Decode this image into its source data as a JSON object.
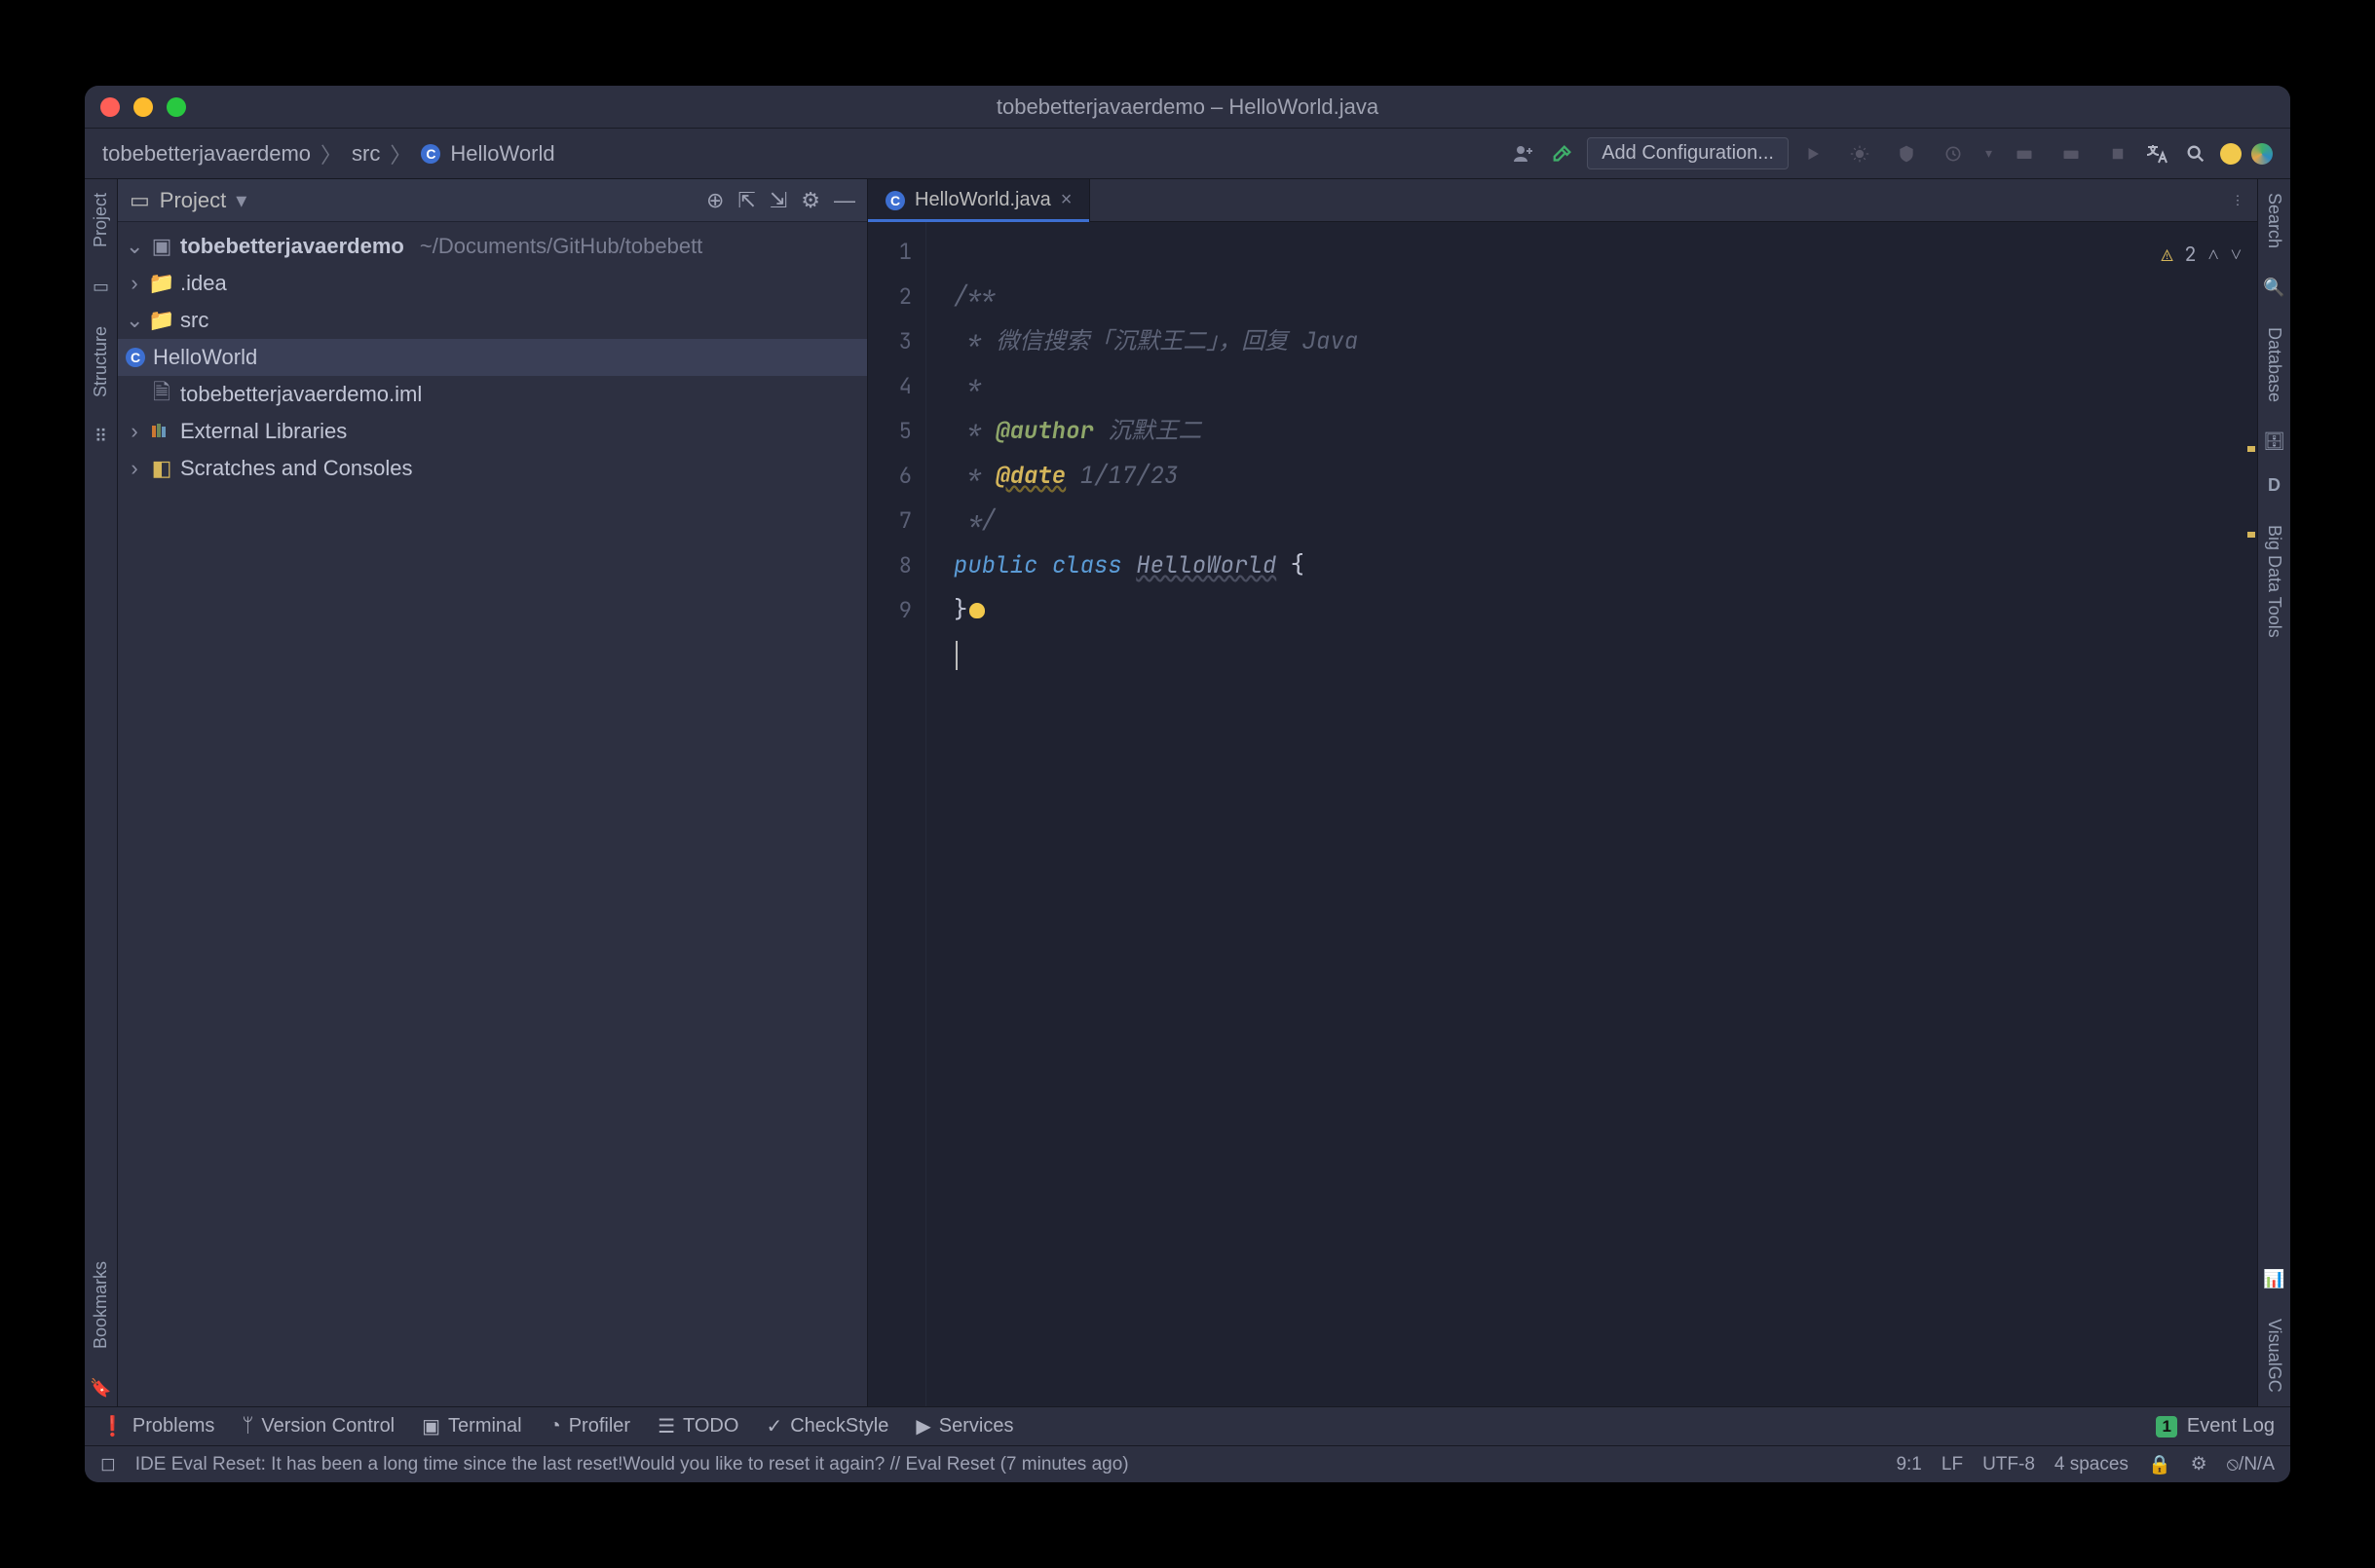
{
  "window_title": "tobebetterjavaerdemo – HelloWorld.java",
  "breadcrumb": {
    "project": "tobebetterjavaerdemo",
    "folder": "src",
    "file": "HelloWorld"
  },
  "toolbar": {
    "add_configuration": "Add Configuration..."
  },
  "left_rail": {
    "project": "Project",
    "structure": "Structure",
    "bookmarks": "Bookmarks"
  },
  "right_rail": {
    "search": "Search",
    "database": "Database",
    "big_data": "Big Data Tools",
    "visualgc": "VisualGC",
    "d_label": "D"
  },
  "project_panel": {
    "title": "Project",
    "root": "tobebetterjavaerdemo",
    "root_path": "~/Documents/GitHub/tobebett",
    "idea_dir": ".idea",
    "src_dir": "src",
    "selected_class": "HelloWorld",
    "iml": "tobebetterjavaerdemo.iml",
    "ext_libs": "External Libraries",
    "scratches": "Scratches and Consoles"
  },
  "editor": {
    "tab_label": "HelloWorld.java",
    "inspection_count": "2",
    "lines": {
      "l1": "/**",
      "l2_prefix": " * ",
      "l2_text": "微信搜索「沉默王二」，回复 Java",
      "l3": " *",
      "l4_prefix": " * ",
      "l4_tag": "@author",
      "l4_val": " 沉默王二",
      "l5_prefix": " * ",
      "l5_tag": "@date",
      "l5_val": " 1/17/23",
      "l6": " */",
      "l7_kw1": "public",
      "l7_kw2": "class",
      "l7_cls": "HelloWorld",
      "l7_brace": " {",
      "l8": "}",
      "l9": ""
    },
    "gutter": [
      "1",
      "2",
      "3",
      "4",
      "5",
      "6",
      "7",
      "8",
      "9"
    ]
  },
  "bottom_tools": {
    "problems": "Problems",
    "vcs": "Version Control",
    "terminal": "Terminal",
    "profiler": "Profiler",
    "todo": "TODO",
    "checkstyle": "CheckStyle",
    "services": "Services",
    "event_log": "Event Log",
    "event_badge": "1"
  },
  "status": {
    "message": "IDE Eval Reset: It has been a long time since the last reset!Would you like to reset it again? // Eval Reset (7 minutes ago)",
    "position": "9:1",
    "line_sep": "LF",
    "encoding": "UTF-8",
    "indent": "4 spaces",
    "readonly": "⦸/N/A"
  }
}
